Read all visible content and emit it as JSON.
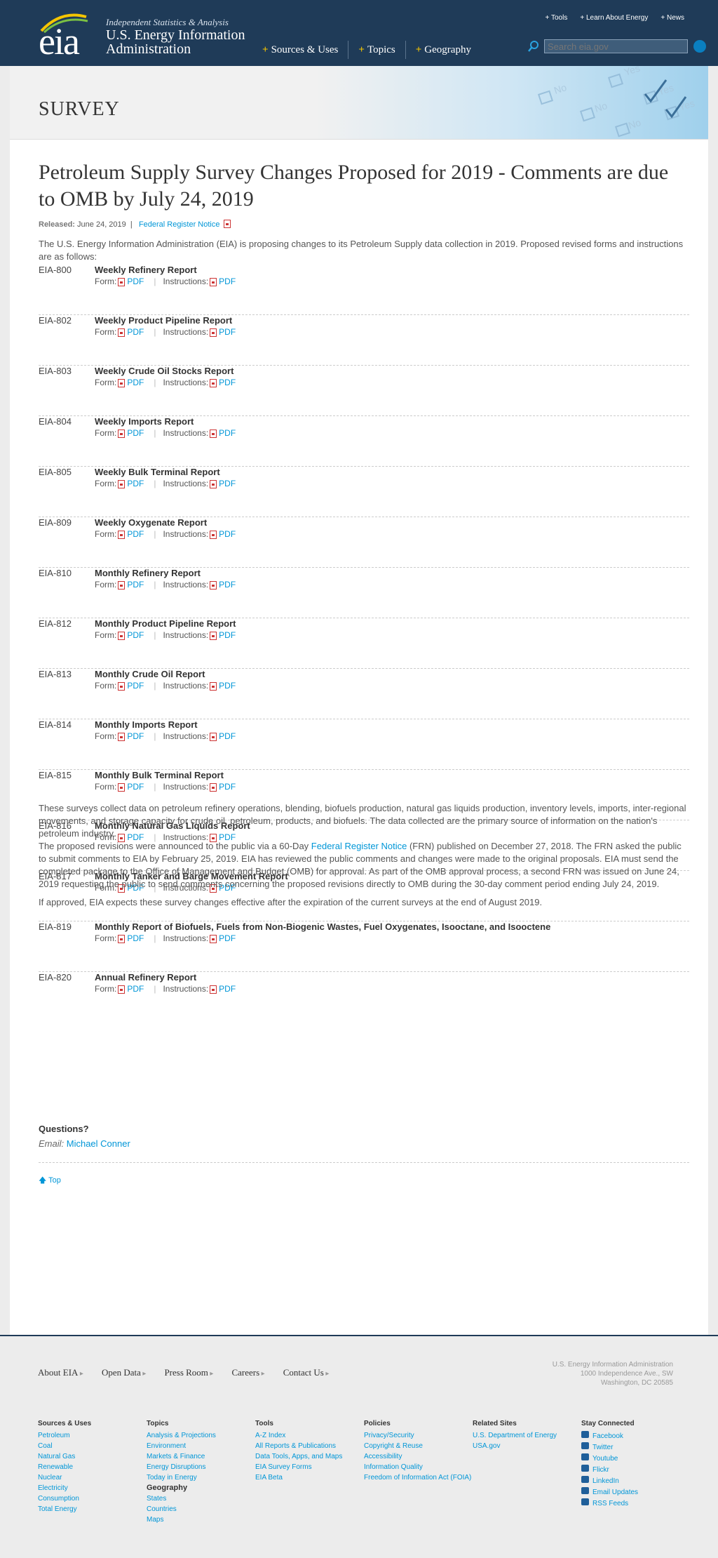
{
  "header": {
    "tagline": "Independent Statistics & Analysis",
    "org_name": "U.S. Energy Information Administration",
    "logo_text": "eia",
    "util_links": [
      "+ Tools",
      "+ Learn About Energy",
      "+ News"
    ],
    "nav": [
      "Sources & Uses",
      "Topics",
      "Geography"
    ],
    "search_placeholder": "Search eia.gov"
  },
  "banner": {
    "title": "SURVEY"
  },
  "article": {
    "title": "Petroleum Supply Survey Changes Proposed for 2019 - Comments are due to OMB by July 24, 2019",
    "released_label": "Released:",
    "released_date": "June 24, 2019",
    "frn_link": "Federal Register Notice",
    "intro": "The U.S. Energy Information Administration (EIA) is proposing changes to its Petroleum Supply data collection in 2019. Proposed revised forms and instructions are as follows:",
    "form_label": "Form:",
    "instructions_label": "Instructions:",
    "pdf_label": "PDF",
    "surveys": [
      {
        "code": "EIA-800",
        "name": "Weekly Refinery Report"
      },
      {
        "code": "EIA-802",
        "name": "Weekly Product Pipeline Report"
      },
      {
        "code": "EIA-803",
        "name": "Weekly Crude Oil Stocks Report"
      },
      {
        "code": "EIA-804",
        "name": "Weekly Imports Report"
      },
      {
        "code": "EIA-805",
        "name": "Weekly Bulk Terminal Report"
      },
      {
        "code": "EIA-809",
        "name": "Weekly Oxygenate Report"
      },
      {
        "code": "EIA-810",
        "name": "Monthly Refinery Report"
      },
      {
        "code": "EIA-812",
        "name": "Monthly Product Pipeline Report"
      },
      {
        "code": "EIA-813",
        "name": "Monthly Crude Oil Report"
      },
      {
        "code": "EIA-814",
        "name": "Monthly Imports Report"
      },
      {
        "code": "EIA-815",
        "name": "Monthly Bulk Terminal Report"
      },
      {
        "code": "EIA-816",
        "name": "Monthly Natural Gas Liquids Report"
      },
      {
        "code": "EIA-817",
        "name": "Monthly Tanker and Barge Movement Report"
      },
      {
        "code": "EIA-819",
        "name": "Monthly Report of Biofuels, Fuels from Non-Biogenic Wastes, Fuel Oxygenates, Isooctane, and Isooctene"
      },
      {
        "code": "EIA-820",
        "name": "Annual Refinery Report"
      }
    ],
    "para1": "These surveys collect data on petroleum refinery operations, blending, biofuels production, natural gas liquids production, inventory levels, imports, inter-regional movements, and storage capacity for crude oil, petroleum, products, and biofuels. The data collected are the primary source of information on the nation's petroleum industry.",
    "para2_before": "The proposed revisions were announced to the public via a 60-Day ",
    "para2_link": "Federal Register Notice",
    "para2_after": " (FRN) published on December 27, 2018. The FRN asked the public to submit comments to EIA by February 25, 2019. EIA has reviewed the public comments and changes were made to the original proposals. EIA must send the completed package to the Office of Management and Budget (OMB) for approval. As part of the OMB approval process, a second FRN was issued on June 24, 2019 requesting the public to send comments concerning the proposed revisions directly to OMB during the 30-day comment period ending July 24, 2019.",
    "para3": "If approved, EIA expects these survey changes effective after the expiration of the current surveys at the end of August 2019.",
    "questions": "Questions?",
    "email_label": "Email:",
    "email_name": "Michael Conner",
    "top_link": "Top"
  },
  "footer": {
    "nav": [
      "About EIA",
      "Open Data",
      "Press Room",
      "Careers",
      "Contact Us"
    ],
    "address": [
      "U.S. Energy Information Administration",
      "1000 Independence Ave., SW",
      "Washington, DC 20585"
    ],
    "columns": [
      {
        "title": "Sources & Uses",
        "links": [
          "Petroleum",
          "Coal",
          "Natural Gas",
          "Renewable",
          "Nuclear",
          "Electricity",
          "Consumption",
          "Total Energy"
        ]
      },
      {
        "title": "Topics",
        "links": [
          "Analysis & Projections",
          "Environment",
          "Markets & Finance",
          "Energy Disruptions",
          "Today in Energy"
        ],
        "subtitle": "Geography",
        "sublinks": [
          "States",
          "Countries",
          "Maps"
        ]
      },
      {
        "title": "Tools",
        "links": [
          "A-Z Index",
          "All Reports & Publications",
          "Data Tools, Apps, and Maps",
          "EIA Survey Forms",
          "EIA Beta"
        ]
      },
      {
        "title": "Policies",
        "links": [
          "Privacy/Security",
          "Copyright & Reuse",
          "Accessibility",
          "Information Quality",
          "Freedom of Information Act (FOIA)"
        ]
      },
      {
        "title": "Related Sites",
        "links": [
          "U.S. Department of Energy",
          "USA.gov"
        ]
      },
      {
        "title": "Stay Connected",
        "links": [
          "Facebook",
          "Twitter",
          "Youtube",
          "Flickr",
          "LinkedIn",
          "Email Updates",
          "RSS Feeds"
        ]
      }
    ]
  },
  "colors": {
    "header_bg": "#1f3b58",
    "link": "#0096d7",
    "accent": "#f5c500"
  }
}
